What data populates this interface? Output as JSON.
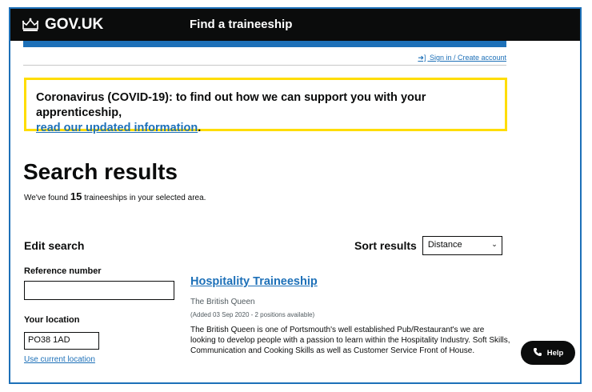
{
  "header": {
    "logo_text": "GOV.UK",
    "service_name": "Find a traineeship",
    "logo_icon": "crown-icon"
  },
  "account": {
    "signin_label": "Sign in / Create account",
    "signin_icon": "sign-in-icon"
  },
  "banner": {
    "text": "Coronavirus (COVID-19): to find out how we can support you with your apprenticeship,",
    "link": "read our updated information",
    "suffix": "."
  },
  "page": {
    "title": "Search results",
    "found_prefix": "We've found",
    "found_count": "15",
    "found_suffix": "traineeships in your selected area."
  },
  "edit_search": {
    "heading": "Edit search",
    "reference_label": "Reference number",
    "reference_value": "",
    "location_label": "Your location",
    "location_value": "PO38 1AD",
    "use_location": "Use current location"
  },
  "sort": {
    "label": "Sort results",
    "selected": "Distance"
  },
  "results": [
    {
      "title": "Hospitality Traineeship",
      "employer": "The British Queen",
      "added": "(Added 03 Sep 2020 - 2 positions available)",
      "description": "The British Queen is one of Portsmouth's well established Pub/Restaurant's we are looking to develop people with a passion to learn within the Hospitality Industry. Soft Skills, Communication and Cooking Skills as well as Customer Service Front of House."
    }
  ],
  "help": {
    "label": "Help",
    "icon": "phone-icon"
  },
  "colors": {
    "header": "#0b0c0c",
    "brand_blue": "#1d70b8",
    "banner_border": "#ffdd00",
    "frame_border": "#1d70b8"
  }
}
